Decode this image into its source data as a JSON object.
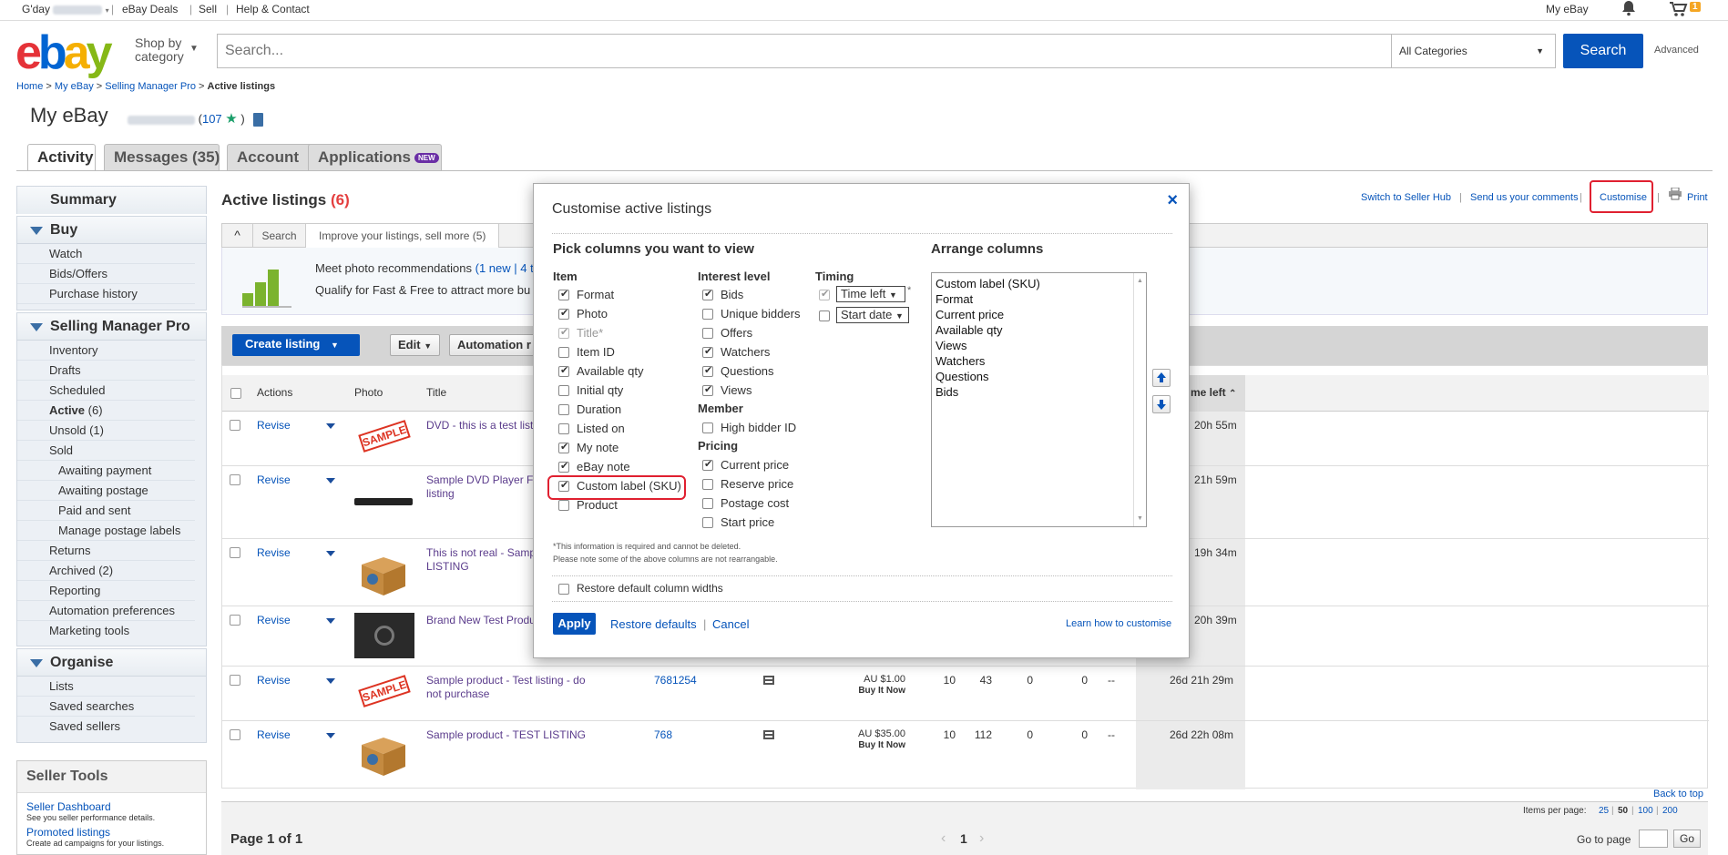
{
  "topbar": {
    "greeting": "G'day",
    "ebay_deals": "eBay Deals",
    "sell": "Sell",
    "help": "Help & Contact",
    "my_ebay": "My eBay",
    "cart_count": "1"
  },
  "header": {
    "logo": [
      "e",
      "b",
      "a",
      "y"
    ],
    "shop_by_1": "Shop by",
    "shop_by_2": "category",
    "search_placeholder": "Search...",
    "category": "All Categories",
    "search_button": "Search",
    "advanced": "Advanced"
  },
  "breadcrumb": {
    "home": "Home",
    "my_ebay": "My eBay",
    "smp": "Selling Manager Pro",
    "current": "Active listings",
    "sep": ">"
  },
  "page": {
    "title": "My eBay",
    "feedback_open": "(",
    "feedback": "107",
    "feedback_close": ")"
  },
  "tabs": {
    "activity": "Activity",
    "messages": "Messages (35)",
    "account": "Account",
    "applications": "Applications",
    "new_badge": "NEW"
  },
  "nav": {
    "summary": "Summary",
    "buy": {
      "title": "Buy",
      "items": [
        "Watch",
        "Bids/Offers",
        "Purchase history"
      ]
    },
    "smp": {
      "title": "Selling Manager Pro",
      "inventory": "Inventory",
      "drafts": "Drafts",
      "scheduled": "Scheduled",
      "active": "Active",
      "active_count": "(6)",
      "unsold": "Unsold",
      "unsold_count": "(1)",
      "sold": "Sold",
      "awaiting_payment": "Awaiting payment",
      "awaiting_postage": "Awaiting postage",
      "paid_sent": "Paid and sent",
      "manage_labels": "Manage postage labels",
      "returns": "Returns",
      "archived": "Archived",
      "archived_count": "(2)",
      "reporting": "Reporting",
      "automation": "Automation preferences",
      "marketing": "Marketing tools"
    },
    "organise": {
      "title": "Organise",
      "items": [
        "Lists",
        "Saved searches",
        "Saved sellers"
      ]
    },
    "seller_tools": {
      "title": "Seller Tools",
      "dashboard": "Seller Dashboard",
      "dashboard_desc": "See you seller performance details.",
      "promoted": "Promoted listings",
      "promoted_desc": "Create ad campaigns for your listings."
    }
  },
  "main": {
    "title": "Active listings",
    "count": "(6)",
    "links": {
      "switch": "Switch to Seller Hub",
      "comments": "Send us your comments",
      "customise": "Customise",
      "print": "Print",
      "sep": "|"
    },
    "subtabs": {
      "search": "Search",
      "improve": "Improve your listings, sell more (5)"
    },
    "promo": {
      "line1": "Meet photo recommendations",
      "line1_link": "(1 new | 4 t",
      "line2": "Qualify for Fast & Free to attract more bu"
    },
    "toolbar": {
      "create": "Create listing",
      "edit": "Edit",
      "automation": "Automation r"
    },
    "columns": {
      "actions": "Actions",
      "photo": "Photo",
      "title": "Title",
      "time_left": "me left"
    },
    "rows": [
      {
        "action": "Revise",
        "title": "DVD - this is a test list",
        "time": "20h 55m",
        "thumb": "sample"
      },
      {
        "action": "Revise",
        "title": "Sample DVD Player F listing",
        "time": "21h 59m",
        "thumb": "dvd"
      },
      {
        "action": "Revise",
        "title": "This is not real - Samp LISTING",
        "time": "19h 34m",
        "thumb": "box"
      },
      {
        "action": "Revise",
        "title": "Brand New Test Produ",
        "time": "20h 39m",
        "thumb": "car"
      },
      {
        "action": "Revise",
        "title": "Sample product - Test listing - do not purchase",
        "item_id": "7681254",
        "price": "AU $1.00",
        "format": "Buy It Now",
        "qty": "10",
        "views": "43",
        "watchers": "0",
        "bids": "0",
        "dash": "--",
        "time": "26d 21h 29m",
        "thumb": "sample"
      },
      {
        "action": "Revise",
        "title": "Sample product - TEST LISTING",
        "item_id": "768",
        "price": "AU $35.00",
        "format": "Buy It Now",
        "qty": "10",
        "views": "112",
        "watchers": "0",
        "bids": "0",
        "dash": "--",
        "time": "26d 22h 08m",
        "thumb": "box"
      }
    ],
    "back_to_top": "Back to top",
    "items_per_page": "Items per page:",
    "ipp": [
      "25",
      "50",
      "100",
      "200"
    ],
    "page_of": "Page 1 of 1",
    "page_num": "1",
    "go_to_page": "Go to page",
    "go": "Go"
  },
  "modal": {
    "title": "Customise active listings",
    "close": "×",
    "pick_heading": "Pick columns you want to view",
    "arrange_heading": "Arrange columns",
    "item_group": "Item",
    "item_opts": [
      {
        "label": "Format",
        "checked": true,
        "disabled": false
      },
      {
        "label": "Photo",
        "checked": true,
        "disabled": false
      },
      {
        "label": "Title*",
        "checked": true,
        "disabled": true
      },
      {
        "label": "Item ID",
        "checked": false,
        "disabled": false
      },
      {
        "label": "Available qty",
        "checked": true,
        "disabled": false
      },
      {
        "label": "Initial qty",
        "checked": false,
        "disabled": false
      },
      {
        "label": "Duration",
        "checked": false,
        "disabled": false
      },
      {
        "label": "Listed on",
        "checked": false,
        "disabled": false
      },
      {
        "label": "My note",
        "checked": true,
        "disabled": false
      },
      {
        "label": "eBay note",
        "checked": true,
        "disabled": false
      },
      {
        "label": "Custom label (SKU)",
        "checked": true,
        "disabled": false
      },
      {
        "label": "Product",
        "checked": false,
        "disabled": false
      }
    ],
    "interest_group": "Interest level",
    "interest_opts": [
      {
        "label": "Bids",
        "checked": true
      },
      {
        "label": "Unique bidders",
        "checked": false
      },
      {
        "label": "Offers",
        "checked": false
      },
      {
        "label": "Watchers",
        "checked": true
      },
      {
        "label": "Questions",
        "checked": true
      },
      {
        "label": "Views",
        "checked": true
      }
    ],
    "member_group": "Member",
    "member_opts": [
      {
        "label": "High bidder ID",
        "checked": false
      }
    ],
    "pricing_group": "Pricing",
    "pricing_opts": [
      {
        "label": "Current price",
        "checked": true
      },
      {
        "label": "Reserve price",
        "checked": false
      },
      {
        "label": "Postage cost",
        "checked": false
      },
      {
        "label": "Start price",
        "checked": false
      }
    ],
    "timing_group": "Timing",
    "timing_time_left": "Time left",
    "timing_start_date": "Start date",
    "timing_star": "*",
    "arrange_list": [
      "Custom label (SKU)",
      "Format",
      "Current price",
      "Available qty",
      "Views",
      "Watchers",
      "Questions",
      "Bids"
    ],
    "note1": "*This information is required and cannot be deleted.",
    "note2": "Please note some of the above columns are not rearrangable.",
    "restore_widths": "Restore default column widths",
    "apply": "Apply",
    "restore_defaults": "Restore defaults",
    "cancel": "Cancel",
    "sep": "|",
    "learn": "Learn how to customise"
  }
}
